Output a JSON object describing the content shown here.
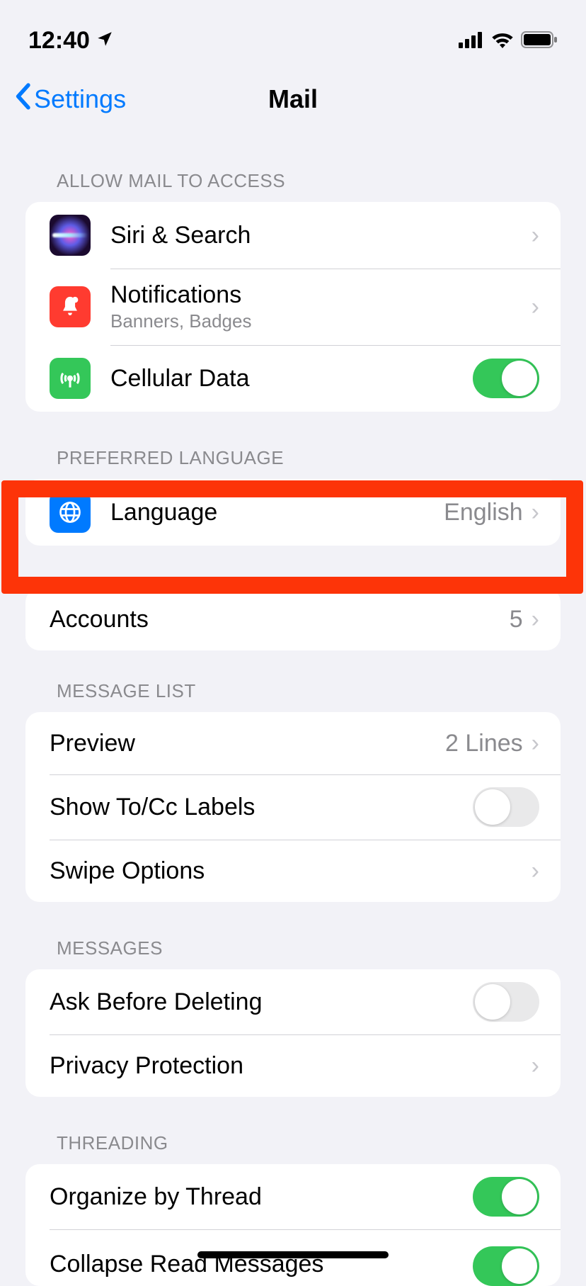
{
  "status": {
    "time": "12:40"
  },
  "nav": {
    "back": "Settings",
    "title": "Mail"
  },
  "sections": {
    "access_header": "ALLOW MAIL TO ACCESS",
    "siri": "Siri & Search",
    "notifications": {
      "label": "Notifications",
      "sub": "Banners, Badges"
    },
    "cellular": "Cellular Data",
    "lang_header": "PREFERRED LANGUAGE",
    "language": {
      "label": "Language",
      "value": "English"
    },
    "accounts": {
      "label": "Accounts",
      "value": "5"
    },
    "msglist_header": "MESSAGE LIST",
    "preview": {
      "label": "Preview",
      "value": "2 Lines"
    },
    "show_tocc": "Show To/Cc Labels",
    "swipe": "Swipe Options",
    "messages_header": "MESSAGES",
    "ask_delete": "Ask Before Deleting",
    "privacy": "Privacy Protection",
    "threading_header": "THREADING",
    "organize": "Organize by Thread",
    "collapse": "Collapse Read Messages"
  },
  "toggles": {
    "cellular": true,
    "show_tocc": false,
    "ask_delete": false,
    "organize": true,
    "collapse": true
  }
}
